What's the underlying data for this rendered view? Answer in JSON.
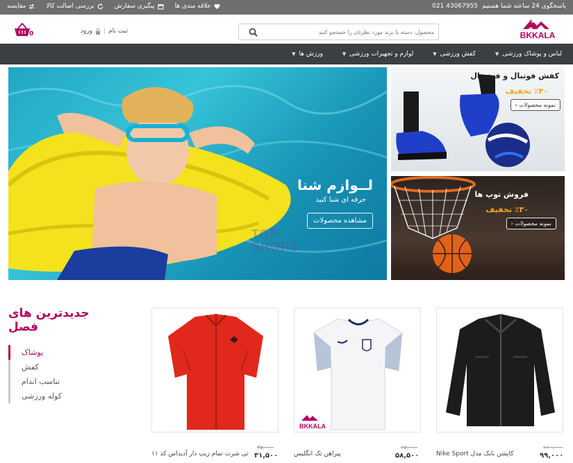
{
  "topbar": {
    "support": "پاسخگوی 24 ساعته شما هستیم",
    "phone": "021 43067955",
    "links": [
      {
        "label": "علاقه مندی ها",
        "icon": "heart-icon"
      },
      {
        "label": "پیگیری سفارش",
        "icon": "calendar-icon"
      },
      {
        "label": "بررسی اصالت کالا",
        "icon": "refresh-icon"
      },
      {
        "label": "مقایسه",
        "icon": "compare-icon"
      }
    ]
  },
  "header": {
    "logo_text": "BKKALA",
    "search_placeholder": "محصول، دسته یا برند مورد نظرتان را جستجو کنید",
    "register": "ثبت نام",
    "login": "ورود",
    "cart_count": "0"
  },
  "nav": {
    "items": [
      "لباس و پوشاک ورزشی",
      "کفش ورزشی",
      "لوازم و تجهیزات ورزشی",
      "ورزش ها"
    ]
  },
  "banners": {
    "main": {
      "title": "لــوازم شنا",
      "subtitle": "حرفه ای شنا کنید",
      "button": "مشاهده محصولات",
      "watermark": "TOP SHOPS"
    },
    "top_right": {
      "title": "کفش فوتبال و فوتسال",
      "discount": "٪۴۰ تخفیف",
      "button": "نمونه محصولات"
    },
    "bottom_right": {
      "title": "فروش توپ ها",
      "discount": "٪۳۰ تخفیف",
      "button": "نمونه محصولات"
    }
  },
  "newest": {
    "title": "جدیدترین های فصل",
    "categories": [
      "پوشاک",
      "کفش",
      "تناسب اندام",
      "کوله ورزشی"
    ],
    "active_category": "پوشاک"
  },
  "products": [
    {
      "name": "کاپشن نایک مدل Nike Sport",
      "old_price": "۱۱۰,۰۰۰",
      "price": "۹۹,۰۰۰"
    },
    {
      "name": "پیراهن تک انگلیس",
      "old_price": "۶۵,۰۰۰",
      "price": "۵۸,۵۰۰"
    },
    {
      "name": "تی شرت تمام زیپ دار آدیداس کد ۱۱",
      "old_price": "۳۵,۰۰۰",
      "price": "۳۱,۵۰۰"
    }
  ],
  "colors": {
    "brand": "#b3005e",
    "nav_bg": "#3b3e42",
    "topbar_bg": "#6f6f6f",
    "discount": "#f5a623"
  }
}
